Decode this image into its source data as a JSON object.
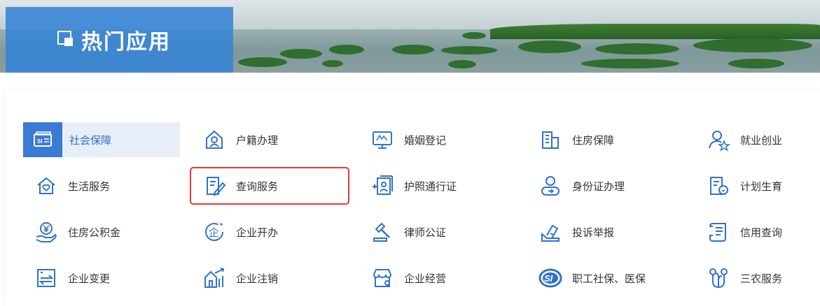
{
  "banner": {
    "title": "热门应用"
  },
  "colors": {
    "accent": "#3a7bd5",
    "icon_stroke": "#2f73c9",
    "highlight": "#e53935"
  },
  "apps": [
    {
      "label": "社会保障",
      "icon": "social-security-card-icon",
      "state": "active"
    },
    {
      "label": "户籍办理",
      "icon": "household-register-icon"
    },
    {
      "label": "婚姻登记",
      "icon": "marriage-register-icon"
    },
    {
      "label": "住房保障",
      "icon": "housing-building-icon"
    },
    {
      "label": "就业创业",
      "icon": "employment-user-star-icon"
    },
    {
      "label": "生活服务",
      "icon": "home-heart-icon"
    },
    {
      "label": "查询服务",
      "icon": "query-document-pen-icon",
      "state": "highlighted"
    },
    {
      "label": "护照通行证",
      "icon": "passport-permit-icon"
    },
    {
      "label": "身份证办理",
      "icon": "id-card-user-icon"
    },
    {
      "label": "计划生育",
      "icon": "family-planning-icon"
    },
    {
      "label": "住房公积金",
      "icon": "housing-fund-yen-icon"
    },
    {
      "label": "企业开办",
      "icon": "enterprise-open-icon"
    },
    {
      "label": "律师公证",
      "icon": "lawyer-gavel-icon"
    },
    {
      "label": "投诉举报",
      "icon": "complaint-report-icon"
    },
    {
      "label": "信用查询",
      "icon": "credit-scroll-icon"
    },
    {
      "label": "企业变更",
      "icon": "enterprise-change-icon"
    },
    {
      "label": "企业注销",
      "icon": "enterprise-cancel-icon"
    },
    {
      "label": "企业经营",
      "icon": "enterprise-store-icon"
    },
    {
      "label": "职工社保、医保",
      "icon": "si-logo-icon"
    },
    {
      "label": "三农服务",
      "icon": "agriculture-sprout-icon"
    }
  ]
}
